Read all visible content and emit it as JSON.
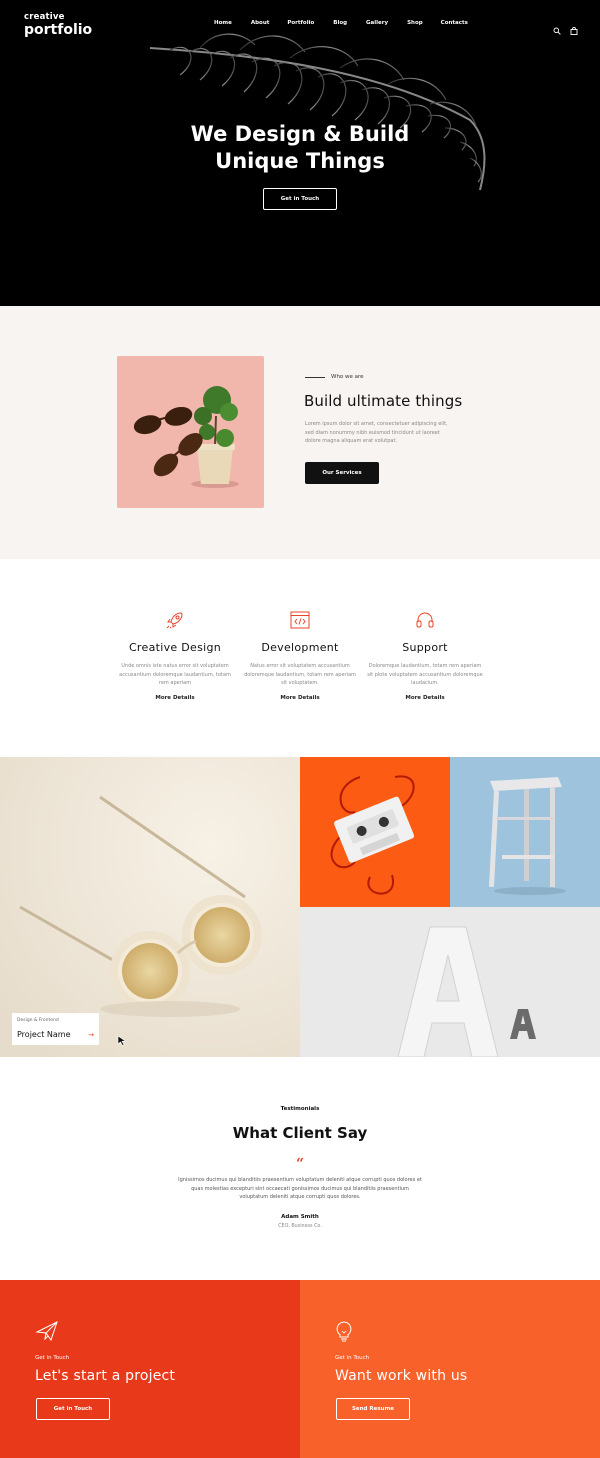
{
  "header": {
    "logo_line1": "creative",
    "logo_line2": "portfolio",
    "nav": [
      "Home",
      "About",
      "Portfolio",
      "Blog",
      "Gallery",
      "Shop",
      "Contacts"
    ],
    "icons": [
      "search-icon",
      "cart-icon"
    ]
  },
  "hero": {
    "title_line1": "We Design & Build",
    "title_line2": "Unique Things",
    "button": "Get in Touch"
  },
  "about": {
    "kicker": "Who we are",
    "title": "Build ultimate things",
    "text": "Lorem ipsum dolor sit amet, consectetuer adipiscing elit, sed diam nonummy nibh euismod tincidunt ut laoreet dolore magna aliquam erat volutpat.",
    "button": "Our Services"
  },
  "services": [
    {
      "icon": "rocket-icon",
      "title": "Creative Design",
      "text": "Unde omnis iste natus error sit voluptatem accusantium doloremque laudantium, totam rem aperiam",
      "more": "More Details"
    },
    {
      "icon": "code-icon",
      "title": "Development",
      "text": "Natus error sit voluptatem accusantium doloremque laudantium, totam rem aperiam sit voluptatem.",
      "more": "More Details"
    },
    {
      "icon": "headphones-icon",
      "title": "Support",
      "text": "Doloremque laudantium, totam rem aperiam sit plote voluptatem accusantium doloremque laudacium.",
      "more": "More Details"
    }
  ],
  "gallery": {
    "card_kicker": "Design & Frontend",
    "card_title": "Project Name",
    "card_arrow": "→",
    "colors": {
      "tape_bg": "#fb5b12",
      "stool_bg": "#9ec4dd"
    }
  },
  "testimonials": {
    "kicker": "Testimonials",
    "title": "What Client Say",
    "quote_mark": "“",
    "text": "Ignissimos ducimus qui blanditiis praesentium voluptatum deleniti atque corrupti quos dolores et quas molestias excepturi sint occaecati gonissimos ducimus qui blanditiis praesentium voluptatum deleniti atque corrupti quos dolores.",
    "name": "Adam Smith",
    "role": "CEO, Business Co."
  },
  "cta": [
    {
      "icon": "paper-plane-icon",
      "kicker": "Get in Touch",
      "title": "Let's start a project",
      "button": "Get in Touch",
      "bg": "#e83a1a"
    },
    {
      "icon": "lightbulb-icon",
      "kicker": "Get in Touch",
      "title": "Want work with us",
      "button": "Send Resume",
      "bg": "#f8612a"
    }
  ]
}
